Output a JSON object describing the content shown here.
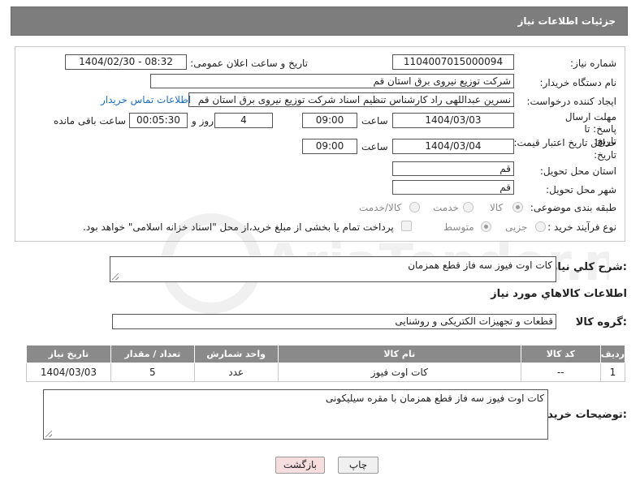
{
  "header": {
    "title": "جزئیات اطلاعات نیاز"
  },
  "form": {
    "need_number_label": "شماره نیاز:",
    "need_number": "1104007015000094",
    "announce_label": "تاریخ و ساعت اعلان عمومی:",
    "announce_value": "1404/02/30 - 08:32",
    "buyer_org_label": "نام دستگاه خریدار:",
    "buyer_org": "شرکت توزیع نیروی برق استان قم",
    "creator_label": "ایجاد کننده درخواست:",
    "creator": "نسرین عبداللهی راد کارشناس تنظیم اسناد شرکت توزیع نیروی برق استان قم",
    "contact_link": "اطلاعات تماس خریدار",
    "deadline_label": "مهلت ارسال پاسخ: تا تاریخ:",
    "deadline_date": "1404/03/03",
    "time_label": "ساعت",
    "deadline_time": "09:00",
    "days_value": "4",
    "days_label": "روز و",
    "remaining_time": "00:05:30",
    "remaining_label": "ساعت باقی مانده",
    "validity_label": "حداقل تاریخ اعتبار قیمت: تا تاریخ:",
    "validity_date": "1404/03/04",
    "validity_time": "09:00",
    "province_label": "استان محل تحویل:",
    "province": "قم",
    "city_label": "شهر محل تحویل:",
    "city": "قم",
    "category_label": "طبقه بندی موضوعی:",
    "category_options": [
      "کالا",
      "خدمت",
      "کالا/خدمت"
    ],
    "category_selected": "کالا",
    "process_label": "نوع فرآیند خرید :",
    "process_options": [
      "جزیی",
      "متوسط"
    ],
    "process_selected": "متوسط",
    "payment_note": "پرداخت تمام یا بخشی از مبلغ خرید،از محل \"اسناد خزانه اسلامی\" خواهد بود."
  },
  "description": {
    "label": "شرح کلي نياز:",
    "value": "کات اوت فیوز سه فاز قطع همزمان"
  },
  "goods_info_title": "اطلاعات کالاهاي مورد نياز",
  "goods_group": {
    "label": "گروه کالا:",
    "value": "قطعات و تجهیزات الکتریکی و روشنایی"
  },
  "table": {
    "headers": [
      "ردیف",
      "کد کالا",
      "نام کالا",
      "واحد شمارش",
      "تعداد / مقدار",
      "تاریخ نیاز"
    ],
    "rows": [
      [
        "1",
        "--",
        "کات اوت فیوز",
        "عدد",
        "5",
        "1404/03/03"
      ]
    ]
  },
  "buyer_notes": {
    "label": "توضیحات خریدار:",
    "value": "کات اوت فیوز سه فاز قطع همزمان با مقره سیلیکونی"
  },
  "buttons": {
    "print": "چاپ",
    "back": "بازگشت"
  },
  "watermark_text": "AriaTender.neT"
}
